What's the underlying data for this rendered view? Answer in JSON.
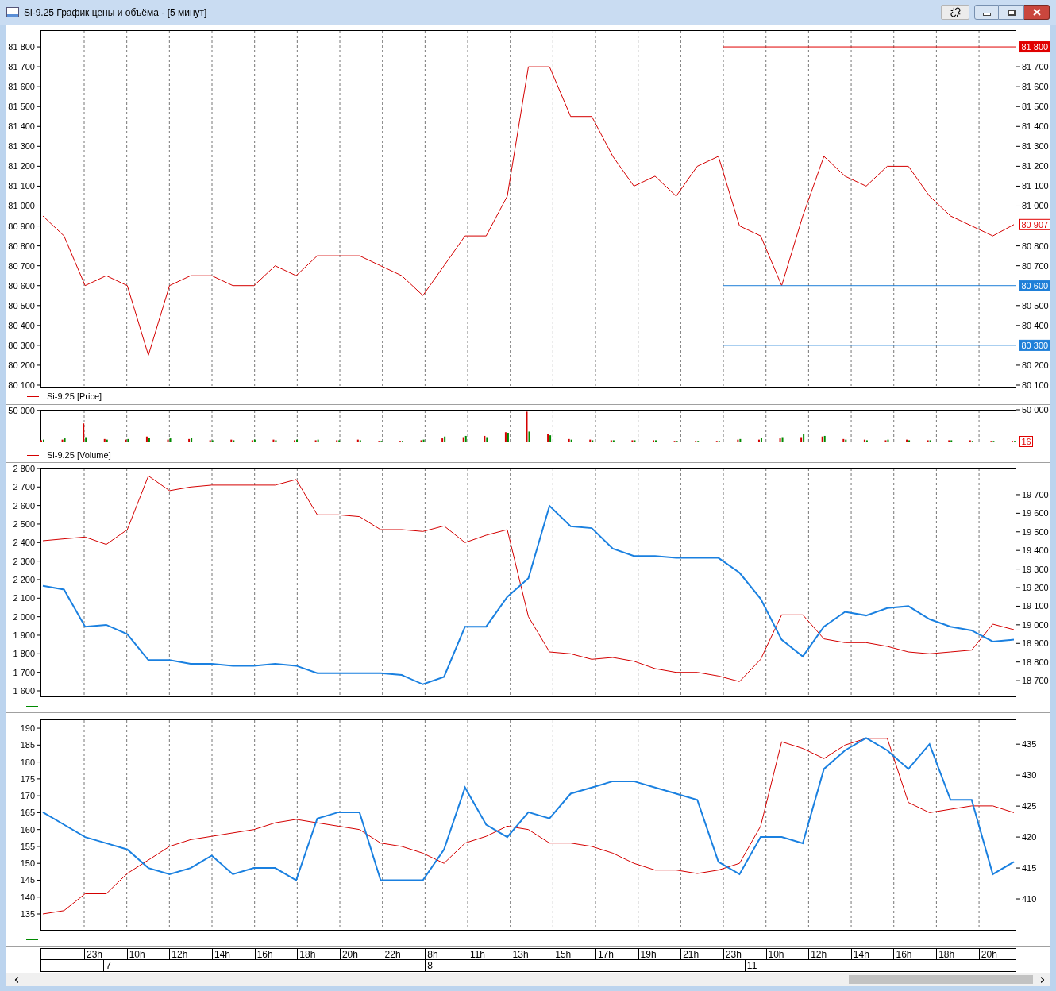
{
  "window": {
    "title": "Si-9.25 График цены и объёма - [5 минут]"
  },
  "panels": [
    {
      "kind": "price",
      "chart_data": {
        "type": "line",
        "grid": "x",
        "ylim": [
          80092,
          81884
        ],
        "yticks": [
          {
            "value": 81800,
            "label": "81 800"
          },
          {
            "value": 81700,
            "label": "81 700"
          },
          {
            "value": 81600,
            "label": "81 600"
          },
          {
            "value": 81500,
            "label": "81 500"
          },
          {
            "value": 81400,
            "label": "81 400"
          },
          {
            "value": 81300,
            "label": "81 300"
          },
          {
            "value": 81200,
            "label": "81 200"
          },
          {
            "value": 81100,
            "label": "81 100"
          },
          {
            "value": 81000,
            "label": "81 000"
          },
          {
            "value": 80900,
            "label": "80 900"
          },
          {
            "value": 80800,
            "label": "80 800"
          },
          {
            "value": 80700,
            "label": "80 700"
          },
          {
            "value": 80600,
            "label": "80 600"
          },
          {
            "value": 80500,
            "label": "80 500"
          },
          {
            "value": 80400,
            "label": "80 400"
          },
          {
            "value": 80300,
            "label": "80 300"
          },
          {
            "value": 80200,
            "label": "80 200"
          },
          {
            "value": 80100,
            "label": "80 100"
          }
        ],
        "y2lim": [
          80092,
          81884
        ],
        "y2ticks": [
          {
            "value": 81700,
            "label": "81 700"
          },
          {
            "value": 81600,
            "label": "81 600"
          },
          {
            "value": 81500,
            "label": "81 500"
          },
          {
            "value": 81400,
            "label": "81 400"
          },
          {
            "value": 81300,
            "label": "81 300"
          },
          {
            "value": 81200,
            "label": "81 200"
          },
          {
            "value": 81100,
            "label": "81 100"
          },
          {
            "value": 81000,
            "label": "81 000"
          },
          {
            "value": 80800,
            "label": "80 800"
          },
          {
            "value": 80700,
            "label": "80 700"
          },
          {
            "value": 80500,
            "label": "80 500"
          },
          {
            "value": 80400,
            "label": "80 400"
          },
          {
            "value": 80200,
            "label": "80 200"
          },
          {
            "value": 80100,
            "label": "80 100"
          }
        ],
        "series": [
          {
            "name": "Si-9.25 [Price]",
            "color": "#d40000",
            "values": [
              80950,
              80850,
              80600,
              80650,
              80600,
              80250,
              80600,
              80650,
              80650,
              80600,
              80600,
              80700,
              80650,
              80750,
              80750,
              80750,
              80700,
              80650,
              80550,
              80700,
              80850,
              80850,
              81050,
              81700,
              81700,
              81450,
              81450,
              81250,
              81100,
              81150,
              81050,
              81200,
              81250,
              80900,
              80850,
              80600,
              80950,
              81250,
              81150,
              81100,
              81200,
              81200,
              81050,
              80950,
              80900,
              80850,
              80907
            ]
          }
        ],
        "ref_lines": [
          {
            "axis": "y",
            "value": 81800,
            "color": "#e00000",
            "label": "81 800"
          },
          {
            "axis": "y",
            "value": 80600,
            "color": "#1f7fd8",
            "label": "80 600"
          },
          {
            "axis": "y",
            "value": 80300,
            "color": "#1f7fd8",
            "label": "80 300"
          }
        ],
        "annotations": [
          "80 907"
        ]
      }
    },
    {
      "kind": "volume",
      "chart_data": {
        "type": "bar",
        "grid": "x",
        "ylim": [
          0,
          51000
        ],
        "yticks": [
          {
            "value": 50000,
            "label": "50 000"
          }
        ],
        "series": [
          {
            "name": "Si-9.25 [Volume]",
            "color": "#d40000",
            "values": [
              2000,
              3000,
              29000,
              4000,
              3000,
              8000,
              3000,
              4000,
              2000,
              3000,
              2000,
              3000,
              2000,
              2000,
              2000,
              3000,
              1000,
              1000,
              2000,
              5000,
              7000,
              9000,
              15000,
              48000,
              12000,
              4000,
              3000,
              2000,
              2000,
              2000,
              1000,
              1000,
              1000,
              3000,
              3000,
              5000,
              7000,
              8000,
              4000,
              3000,
              2000,
              3000,
              2000,
              2000,
              2000,
              1000,
              1000
            ]
          },
          {
            "color": "#008a00",
            "values": [
              3000,
              5000,
              7000,
              3000,
              4000,
              6000,
              5000,
              6000,
              2000,
              2000,
              3000,
              2000,
              3000,
              3000,
              2000,
              2000,
              1000,
              1000,
              3000,
              8000,
              9000,
              7000,
              14000,
              16000,
              10000,
              3000,
              2000,
              2000,
              2000,
              2000,
              1000,
              1000,
              1000,
              4000,
              6000,
              7000,
              12000,
              9000,
              3000,
              2000,
              3000,
              2000,
              2000,
              2000,
              1000,
              1000,
              1000
            ]
          }
        ],
        "annotations": [
          "50 000",
          "16"
        ]
      }
    },
    {
      "kind": "dual",
      "legend": {
        "color": "#008a00"
      },
      "chart_data": {
        "type": "line",
        "grid": "x",
        "ylim": [
          1570,
          2804
        ],
        "yticks": [
          {
            "value": 2800,
            "label": "2 800"
          },
          {
            "value": 2700,
            "label": "2 700"
          },
          {
            "value": 2600,
            "label": "2 600"
          },
          {
            "value": 2500,
            "label": "2 500"
          },
          {
            "value": 2400,
            "label": "2 400"
          },
          {
            "value": 2300,
            "label": "2 300"
          },
          {
            "value": 2200,
            "label": "2 200"
          },
          {
            "value": 2100,
            "label": "2 100"
          },
          {
            "value": 2000,
            "label": "2 000"
          },
          {
            "value": 1900,
            "label": "1 900"
          },
          {
            "value": 1800,
            "label": "1 800"
          },
          {
            "value": 1700,
            "label": "1 700"
          },
          {
            "value": 1600,
            "label": "1 600"
          }
        ],
        "y2lim": [
          18615,
          19845
        ],
        "y2ticks": [
          {
            "value": 19700,
            "label": "19 700"
          },
          {
            "value": 19600,
            "label": "19 600"
          },
          {
            "value": 19500,
            "label": "19 500"
          },
          {
            "value": 19400,
            "label": "19 400"
          },
          {
            "value": 19300,
            "label": "19 300"
          },
          {
            "value": 19200,
            "label": "19 200"
          },
          {
            "value": 19100,
            "label": "19 100"
          },
          {
            "value": 19000,
            "label": "19 000"
          },
          {
            "value": 18900,
            "label": "18 900"
          },
          {
            "value": 18800,
            "label": "18 800"
          },
          {
            "value": 18700,
            "label": "18 700"
          }
        ],
        "series": [
          {
            "color": "#d40000",
            "values": [
              2410,
              2420,
              2430,
              2390,
              2470,
              2760,
              2680,
              2700,
              2710,
              2710,
              2710,
              2710,
              2740,
              2550,
              2550,
              2540,
              2470,
              2470,
              2460,
              2490,
              2400,
              2440,
              2470,
              2000,
              1810,
              1800,
              1770,
              1780,
              1760,
              1720,
              1700,
              1700,
              1680,
              1650,
              1770,
              2010,
              2010,
              1880,
              1860,
              1860,
              1840,
              1810,
              1800,
              1810,
              1820,
              1960,
              1930
            ]
          },
          {
            "color": "#1a80e0",
            "axis": "y2",
            "values": [
              19210,
              19190,
              18990,
              19000,
              18950,
              18810,
              18810,
              18790,
              18790,
              18780,
              18780,
              18790,
              18780,
              18740,
              18740,
              18740,
              18740,
              18730,
              18680,
              18720,
              18990,
              18990,
              19150,
              19250,
              19640,
              19530,
              19520,
              19410,
              19370,
              19370,
              19360,
              19360,
              19360,
              19280,
              19140,
              18920,
              18830,
              18990,
              19070,
              19050,
              19090,
              19100,
              19030,
              18990,
              18970,
              18910,
              18920
            ]
          }
        ]
      }
    },
    {
      "kind": "dual",
      "legend": {
        "color": "#008a00"
      },
      "chart_data": {
        "type": "line",
        "grid": "x",
        "ylim": [
          130.3,
          192.6
        ],
        "yticks": [
          {
            "value": 190,
            "label": "190"
          },
          {
            "value": 185,
            "label": "185"
          },
          {
            "value": 180,
            "label": "180"
          },
          {
            "value": 175,
            "label": "175"
          },
          {
            "value": 170,
            "label": "170"
          },
          {
            "value": 165,
            "label": "165"
          },
          {
            "value": 160,
            "label": "160"
          },
          {
            "value": 155,
            "label": "155"
          },
          {
            "value": 150,
            "label": "150"
          },
          {
            "value": 145,
            "label": "145"
          },
          {
            "value": 140,
            "label": "140"
          },
          {
            "value": 135,
            "label": "135"
          }
        ],
        "y2lim": [
          405,
          439
        ],
        "y2ticks": [
          {
            "value": 435,
            "label": "435"
          },
          {
            "value": 430,
            "label": "430"
          },
          {
            "value": 425,
            "label": "425"
          },
          {
            "value": 420,
            "label": "420"
          },
          {
            "value": 415,
            "label": "415"
          },
          {
            "value": 410,
            "label": "410"
          }
        ],
        "series": [
          {
            "color": "#d40000",
            "values": [
              135,
              136,
              141,
              141,
              147,
              151,
              155,
              157,
              158,
              159,
              160,
              162,
              163,
              162,
              161,
              160,
              156,
              155,
              153,
              150,
              156,
              158,
              161,
              160,
              156,
              156,
              155,
              153,
              150,
              148,
              148,
              147,
              148,
              150,
              161,
              186,
              184,
              181,
              185,
              187,
              187,
              168,
              165,
              166,
              167,
              167,
              165
            ]
          },
          {
            "color": "#1a80e0",
            "axis": "y2",
            "values": [
              424,
              422,
              420,
              419,
              418,
              415,
              414,
              415,
              417,
              414,
              415,
              415,
              413,
              423,
              424,
              424,
              413,
              413,
              413,
              418,
              428,
              422,
              420,
              424,
              423,
              427,
              428,
              429,
              429,
              428,
              427,
              426,
              416,
              414,
              420,
              420,
              419,
              431,
              434,
              436,
              434,
              431,
              435,
              426,
              426,
              414,
              416
            ]
          }
        ]
      }
    }
  ],
  "time_axis": {
    "hours": [
      "23h",
      "10h",
      "12h",
      "14h",
      "16h",
      "18h",
      "20h",
      "22h",
      "8h",
      "11h",
      "13h",
      "15h",
      "17h",
      "19h",
      "21h",
      "23h",
      "10h",
      "12h",
      "14h",
      "16h",
      "18h",
      "20h"
    ],
    "days": [
      "7",
      "8",
      "11"
    ]
  }
}
